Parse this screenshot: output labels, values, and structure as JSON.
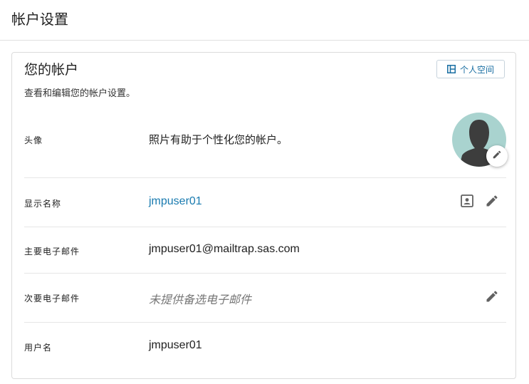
{
  "page": {
    "title": "帐户设置"
  },
  "card": {
    "title": "您的帐户",
    "subtitle": "查看和编辑您的帐户设置。",
    "personal_space_button": "个人空间"
  },
  "rows": {
    "avatar": {
      "label": "头像",
      "value": "照片有助于个性化您的帐户。"
    },
    "display_name": {
      "label": "显示名称",
      "value": "jmpuser01"
    },
    "primary_email": {
      "label": "主要电子邮件",
      "value": "jmpuser01@mailtrap.sas.com"
    },
    "secondary_email": {
      "label": "次要电子邮件",
      "value": "未提供备选电子邮件"
    },
    "username": {
      "label": "用户名",
      "value": "jmpuser01"
    }
  },
  "icons": {
    "personal_space": "layout-panel-icon",
    "avatar_edit": "pencil-icon",
    "display_name_card": "contact-card-icon",
    "display_name_edit": "pencil-icon",
    "secondary_email_edit": "pencil-icon"
  },
  "colors": {
    "link": "#1a7bb0",
    "avatar_bg": "#a9d3cf",
    "avatar_silhouette": "#3d3d3d",
    "icon": "#616161"
  }
}
